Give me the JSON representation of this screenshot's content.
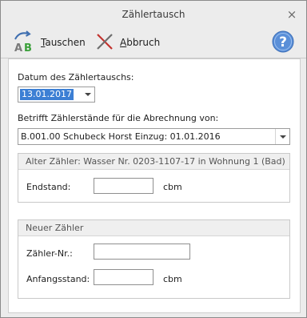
{
  "window": {
    "title": "Zählertausch",
    "close_glyph": "×"
  },
  "toolbar": {
    "tauschen": {
      "mnemonic": "T",
      "rest": "auschen",
      "icon": "ab-swap-icon"
    },
    "abbruch": {
      "mnemonic": "A",
      "rest": "bbruch",
      "icon": "cancel-cross-icon"
    },
    "help": {
      "glyph": "?",
      "icon": "help-icon"
    }
  },
  "form": {
    "date_label": "Datum des Zählertauschs:",
    "date_value": "13.01.2017",
    "billing_label": "Betrifft Zählerstände für die Abrechnung von:",
    "billing_value": "B.001.00 Schubeck Horst Einzug: 01.01.2016"
  },
  "old_meter": {
    "header": "Alter Zähler: Wasser Nr. 0203-1107-17 in Wohnung 1 (Bad)",
    "endstand_label": "Endstand:",
    "endstand_value": "",
    "unit": "cbm"
  },
  "new_meter": {
    "header": "Neuer Zähler",
    "number_label": "Zähler-Nr.:",
    "number_value": "",
    "start_label": "Anfangsstand:",
    "start_value": "",
    "unit": "cbm"
  },
  "colors": {
    "selection": "#3c7fd4",
    "help_blue": "#5a8fd8",
    "cancel_red": "#c2332e"
  }
}
